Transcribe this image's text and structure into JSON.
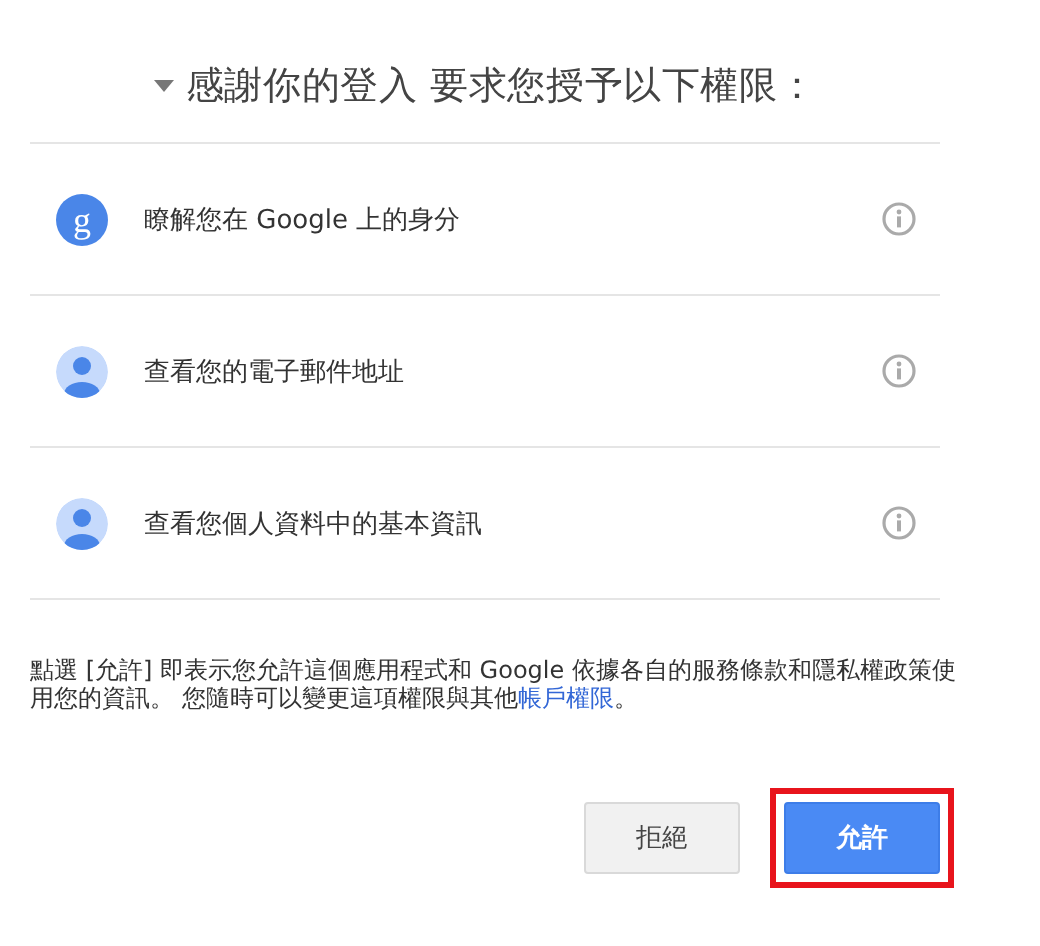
{
  "heading": {
    "title": "感謝你的登入 要求您授予以下權限：",
    "collapsible": true
  },
  "permissions": [
    {
      "kind": "google",
      "badge": "g",
      "label": "瞭解您在 Google 上的身分"
    },
    {
      "kind": "person",
      "label": "查看您的電子郵件地址"
    },
    {
      "kind": "person",
      "label": "查看您個人資料中的基本資訊"
    }
  ],
  "notice": {
    "text": "點選 [允許] 即表示您允許這個應用程式和 Google 依據各自的服務條款和隱私權政策使用您的資訊。 您隨時可以變更這項權限與其他",
    "link": "帳戶權限",
    "end": "。"
  },
  "buttons": [
    {
      "kind": "secondary",
      "label": "拒絕",
      "highlighted": false
    },
    {
      "kind": "primary",
      "label": "允許",
      "highlighted": true
    }
  ]
}
